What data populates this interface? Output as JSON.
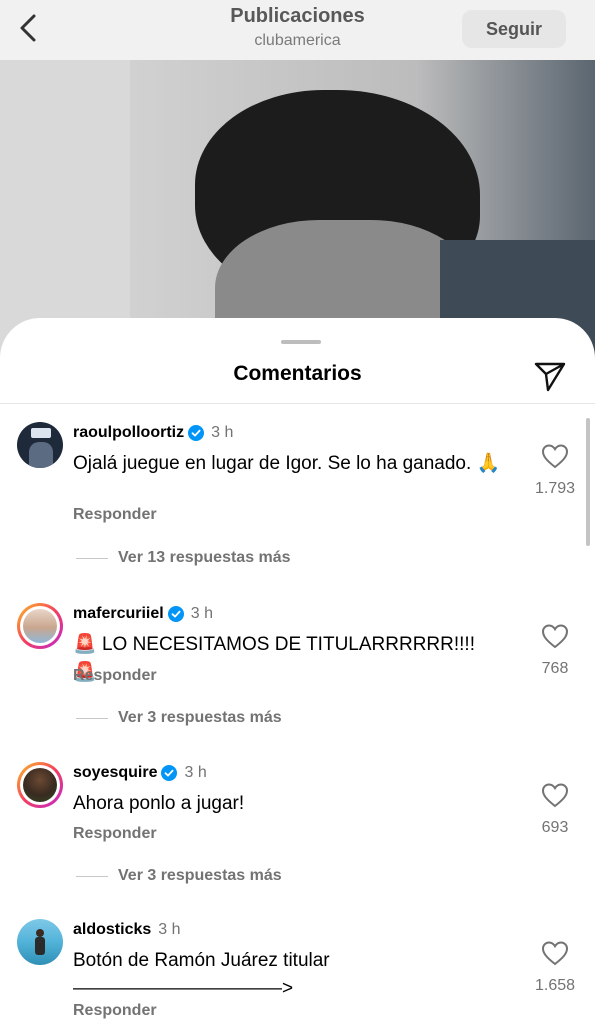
{
  "header": {
    "title": "Publicaciones",
    "subtitle": "clubamerica",
    "follow_label": "Seguir",
    "back_icon": "chevron-left-icon"
  },
  "sheet": {
    "title": "Comentarios",
    "share_icon": "send-icon"
  },
  "comments": [
    {
      "username": "raoulpolloortiz",
      "verified": true,
      "time": "3 h",
      "text": "Ojalá juegue en lugar de Igor. Se lo ha ganado. 🙏",
      "reply_label": "Responder",
      "replies_label": "Ver 13 respuestas más",
      "likes": "1.793"
    },
    {
      "username": "mafercuriiel",
      "verified": true,
      "time": "3 h",
      "text_prefix": "🚨",
      "text_main": "LO NECESITAMOS DE TITULARRRRRR!!!!",
      "text_suffix": "🚨",
      "reply_label": "Responder",
      "replies_label": "Ver 3 respuestas más",
      "likes": "768"
    },
    {
      "username": "soyesquire",
      "verified": true,
      "time": "3 h",
      "text": "Ahora ponlo a jugar!",
      "reply_label": "Responder",
      "replies_label": "Ver 3 respuestas más",
      "likes": "693"
    },
    {
      "username": "aldosticks",
      "verified": false,
      "time": "3 h",
      "text": "Botón de Ramón Juárez titular",
      "text_line2": "———————————>",
      "reply_label": "Responder",
      "likes": "1.658"
    }
  ],
  "colors": {
    "verified": "#0095f6",
    "muted": "#737373",
    "alert": "#e11d48"
  }
}
